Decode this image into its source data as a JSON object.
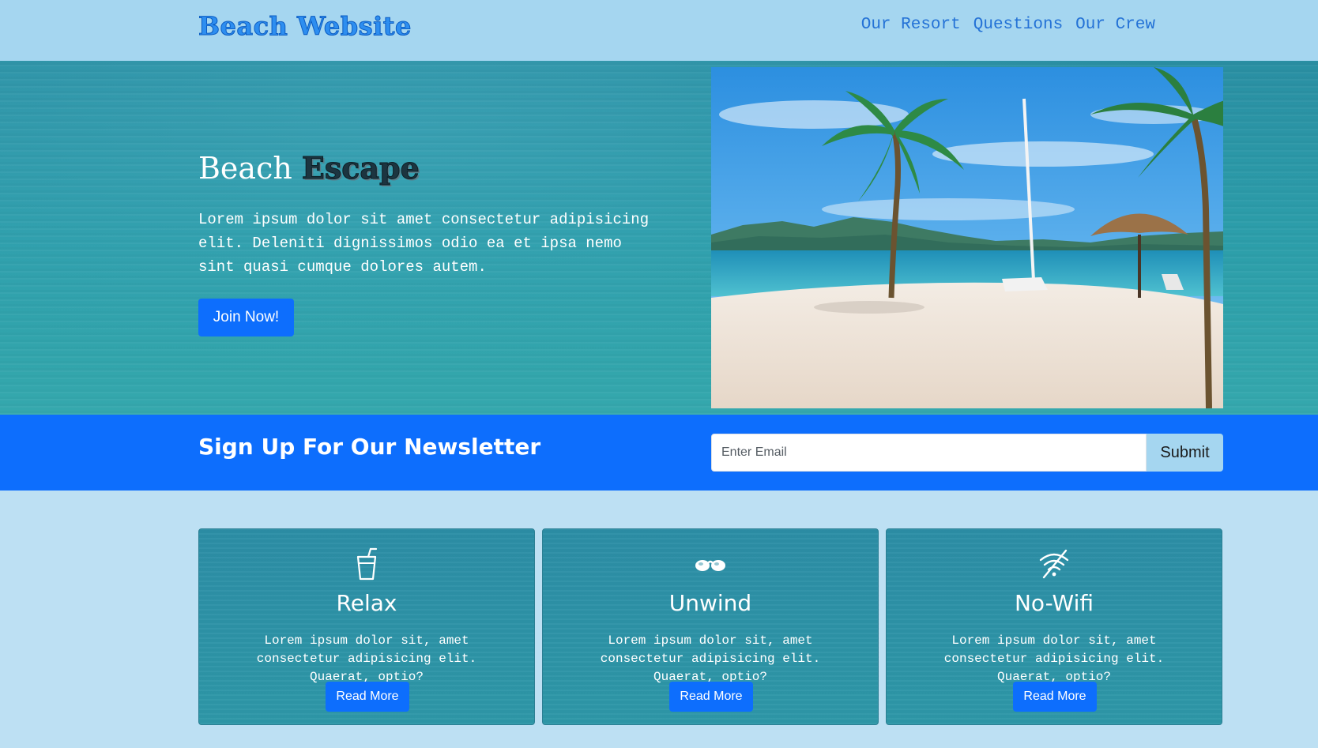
{
  "navbar": {
    "brand": "Beach Website",
    "links": [
      "Our Resort",
      "Questions",
      "Our Crew"
    ]
  },
  "hero": {
    "title_plain": "Beach",
    "title_accent": "Escape",
    "text": "Lorem ipsum dolor sit amet consectetur adipisicing elit. Deleniti dignissimos odio ea et ipsa nemo sint quasi cumque dolores autem.",
    "button": "Join Now!"
  },
  "newsletter": {
    "title": "Sign Up For Our Newsletter",
    "email_placeholder": "Enter Email",
    "submit": "Submit"
  },
  "features": [
    {
      "icon": "cup-straw-icon",
      "title": "Relax",
      "text": "Lorem ipsum dolor sit, amet consectetur adipisicing elit. Quaerat, optio?",
      "button": "Read More"
    },
    {
      "icon": "sunglasses-icon",
      "title": "Unwind",
      "text": "Lorem ipsum dolor sit, amet consectetur adipisicing elit. Quaerat, optio?",
      "button": "Read More"
    },
    {
      "icon": "wifi-off-icon",
      "title": "No-Wifi",
      "text": "Lorem ipsum dolor sit, amet consectetur adipisicing elit. Quaerat, optio?",
      "button": "Read More"
    }
  ],
  "colors": {
    "navbar_bg": "#a5d6f0",
    "page_bg": "#bde0f3",
    "primary": "#0d6efd",
    "hero_bg": "#2c9eaa"
  }
}
